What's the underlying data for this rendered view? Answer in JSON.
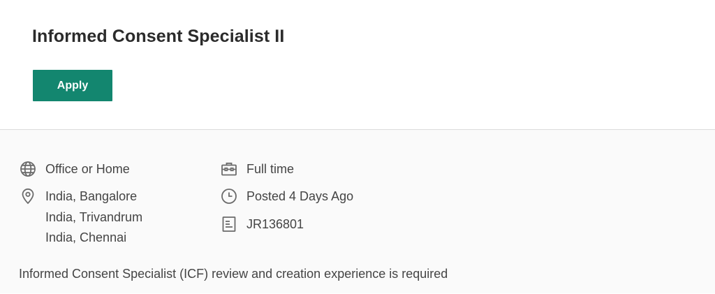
{
  "job": {
    "title": "Informed Consent Specialist II",
    "apply_label": "Apply"
  },
  "details": {
    "work_mode": "Office or Home",
    "locations": [
      "India, Bangalore",
      "India, Trivandrum",
      "India, Chennai"
    ],
    "employment_type": "Full time",
    "posted": "Posted 4 Days Ago",
    "requisition_id": "JR136801"
  },
  "description": "Informed Consent Specialist (ICF) review and creation experience is required",
  "icons": {
    "work_mode": "globe-icon",
    "locations": "location-pin-icon",
    "employment_type": "briefcase-icon",
    "posted": "clock-icon",
    "requisition_id": "document-icon"
  },
  "colors": {
    "accent": "#13866f",
    "icon": "#6b6b6b",
    "text": "#444444"
  }
}
